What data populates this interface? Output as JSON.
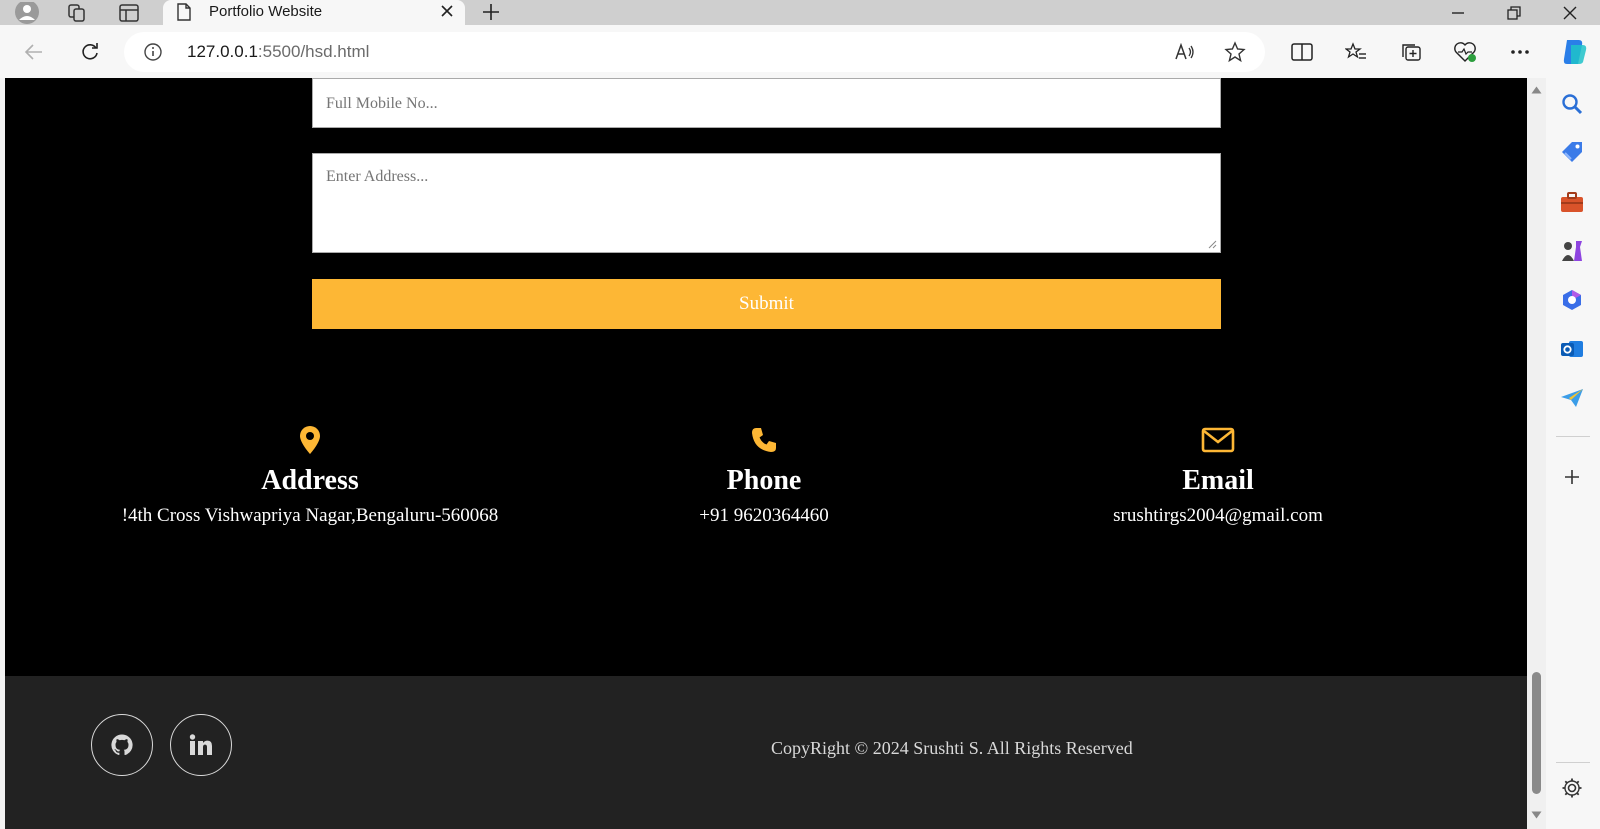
{
  "browser": {
    "tab_title": "Portfolio Website",
    "url_host": "127.0.0.1",
    "url_path": ":5500/hsd.html"
  },
  "form": {
    "mobile_placeholder": "Full Mobile No...",
    "address_placeholder": "Enter Address...",
    "submit_label": "Submit"
  },
  "contact": {
    "address": {
      "heading": "Address",
      "value": "!4th Cross Vishwapriya Nagar,Bengaluru-560068",
      "icon": "map-pin-icon"
    },
    "phone": {
      "heading": "Phone",
      "value": "+91 9620364460",
      "icon": "phone-icon"
    },
    "email": {
      "heading": "Email",
      "value": "srushtirgs2004@gmail.com",
      "icon": "envelope-icon"
    }
  },
  "footer": {
    "copyright": "CopyRight © 2024 Srushti S. All Rights Reserved",
    "social": [
      "github-icon",
      "linkedin-icon"
    ]
  },
  "colors": {
    "accent": "#fdb735",
    "page_bg": "#000000",
    "footer_bg": "#222222"
  }
}
